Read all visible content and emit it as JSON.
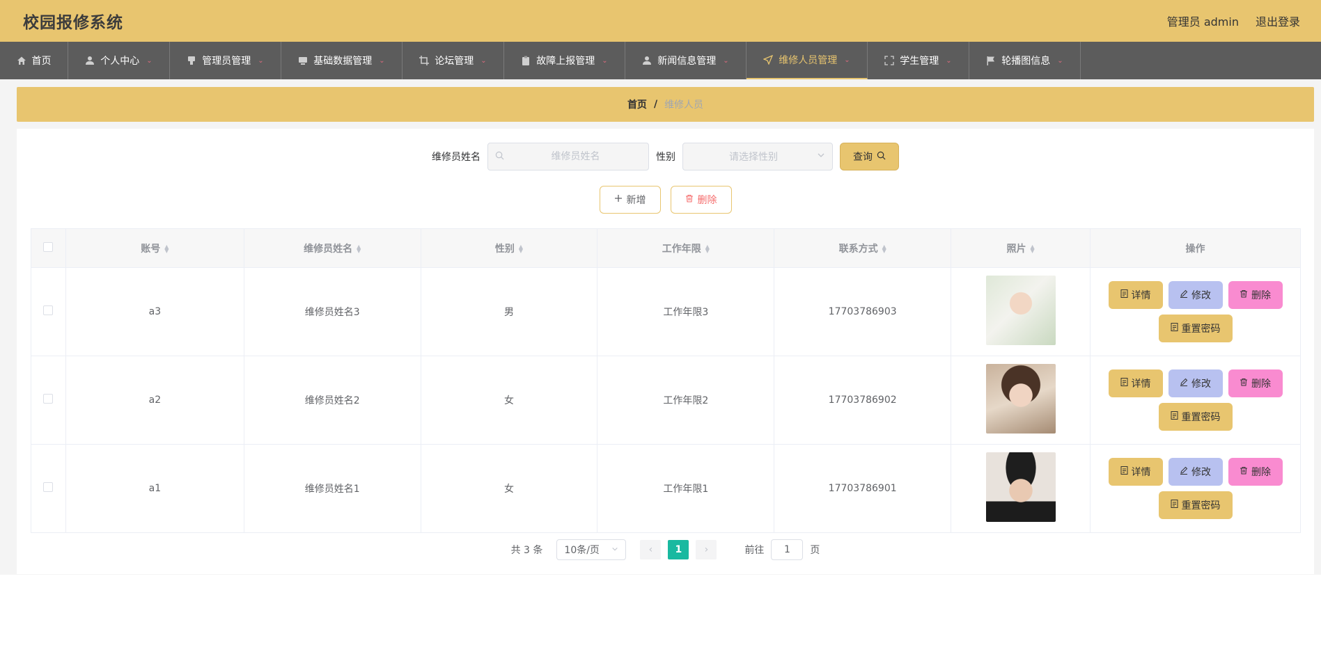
{
  "header": {
    "title": "校园报修系统",
    "user_label": "管理员 admin",
    "logout_label": "退出登录"
  },
  "nav": {
    "items": [
      {
        "label": "首页",
        "icon": "home-icon",
        "has_dropdown": false,
        "active": false
      },
      {
        "label": "个人中心",
        "icon": "user-icon",
        "has_dropdown": true,
        "active": false
      },
      {
        "label": "管理员管理",
        "icon": "stamp-icon",
        "has_dropdown": true,
        "active": false
      },
      {
        "label": "基础数据管理",
        "icon": "monitor-icon",
        "has_dropdown": true,
        "active": false
      },
      {
        "label": "论坛管理",
        "icon": "crop-icon",
        "has_dropdown": true,
        "active": false
      },
      {
        "label": "故障上报管理",
        "icon": "clipboard-icon",
        "has_dropdown": true,
        "active": false
      },
      {
        "label": "新闻信息管理",
        "icon": "user-icon",
        "has_dropdown": true,
        "active": false
      },
      {
        "label": "维修人员管理",
        "icon": "send-icon",
        "has_dropdown": true,
        "active": true
      },
      {
        "label": "学生管理",
        "icon": "fullscreen-icon",
        "has_dropdown": true,
        "active": false
      },
      {
        "label": "轮播图信息",
        "icon": "flag-icon",
        "has_dropdown": true,
        "active": false
      }
    ]
  },
  "breadcrumb": {
    "home": "首页",
    "separator": "/",
    "current": "维修人员"
  },
  "search": {
    "name_label": "维修员姓名",
    "name_placeholder": "维修员姓名",
    "gender_label": "性别",
    "gender_placeholder": "请选择性别",
    "query_label": "查询"
  },
  "actions": {
    "add_label": "新增",
    "delete_label": "删除"
  },
  "table": {
    "columns": [
      "账号",
      "维修员姓名",
      "性别",
      "工作年限",
      "联系方式",
      "照片",
      "操作"
    ],
    "rows": [
      {
        "account": "a3",
        "name": "维修员姓名3",
        "gender": "男",
        "years": "工作年限3",
        "phone": "17703786903"
      },
      {
        "account": "a2",
        "name": "维修员姓名2",
        "gender": "女",
        "years": "工作年限2",
        "phone": "17703786902"
      },
      {
        "account": "a1",
        "name": "维修员姓名1",
        "gender": "女",
        "years": "工作年限1",
        "phone": "17703786901"
      }
    ],
    "op_labels": {
      "detail": "详情",
      "edit": "修改",
      "delete": "删除",
      "reset": "重置密码"
    }
  },
  "pagination": {
    "total_text": "共 3 条",
    "page_size": "10条/页",
    "current_page": "1",
    "goto_label": "前往",
    "goto_value": "1",
    "page_suffix": "页"
  },
  "colors": {
    "accent": "#e8c56f",
    "nav_bg": "#5c5c5c",
    "edit": "#b8c1f0",
    "delete": "#f98bd0",
    "page_active": "#19b9a0"
  }
}
